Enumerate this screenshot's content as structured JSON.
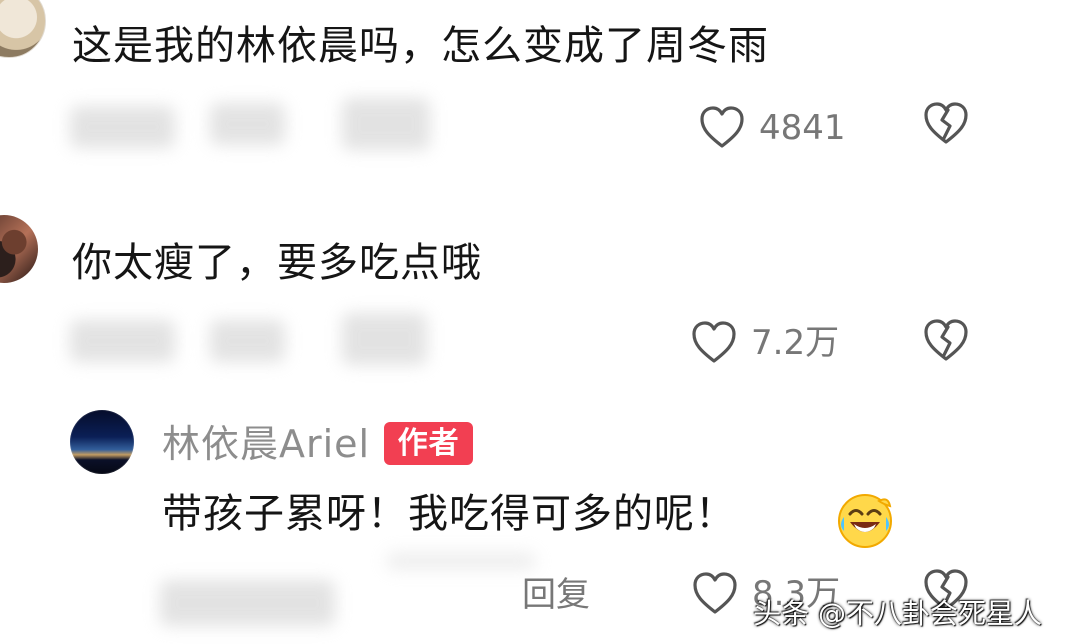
{
  "comments": [
    {
      "text": "这是我的林依晨吗，怎么变成了周冬雨",
      "likes": "4841"
    },
    {
      "text": "你太瘦了，要多吃点哦",
      "likes": "7.2万"
    }
  ],
  "author_reply": {
    "name": "林依晨Ariel",
    "badge": "作者",
    "text": "带孩子累呀！我吃得可多的呢！",
    "emoji": "rolling-on-floor-laughing",
    "likes": "8.3万",
    "reply_label": "回复"
  },
  "watermark": "头条 @不八卦会死星人",
  "icons": {
    "like": "heart-icon",
    "dislike": "broken-heart-icon",
    "emoji": "laughing-emoji-icon"
  },
  "colors": {
    "text": "#151515",
    "meta": "#777777",
    "author_badge": "#f23f52"
  }
}
